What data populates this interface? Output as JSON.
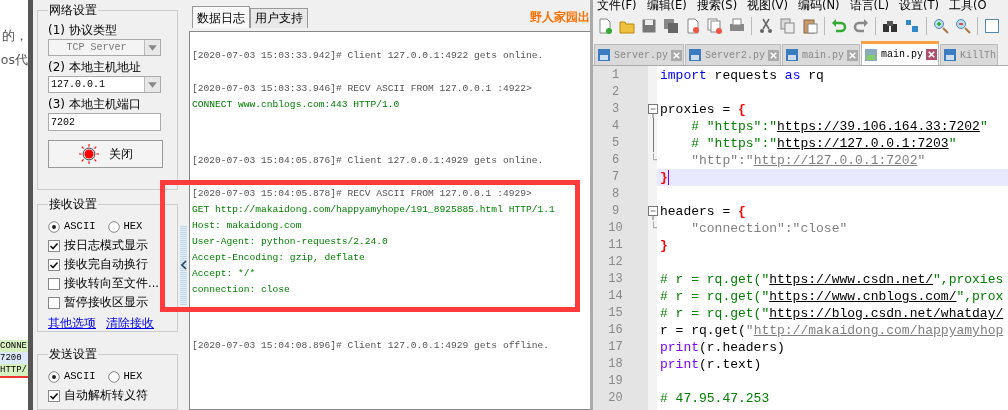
{
  "browser_fragment": {
    "texts": [
      "的，",
      "os代"
    ],
    "log_snippets": [
      "CONNE",
      "7200",
      "HTTP/"
    ]
  },
  "net_settings": {
    "title": "网络设置",
    "protocol_label": "(1) 协议类型",
    "protocol": "TCP Server",
    "protocol_disabled": true,
    "host_label": "(2) 本地主机地址",
    "host": "127.0.0.1",
    "port_label": "(3) 本地主机端口",
    "port": "7202",
    "connect_button": "关闭",
    "connected": true
  },
  "recv_settings": {
    "title": "接收设置",
    "modes": [
      {
        "label": "ASCII",
        "selected": true
      },
      {
        "label": "HEX",
        "selected": false
      }
    ],
    "options": [
      {
        "label": "按日志模式显示",
        "checked": true
      },
      {
        "label": "接收完自动换行",
        "checked": true
      },
      {
        "label": "接收转向至文件...",
        "checked": false
      },
      {
        "label": "暂停接收区显示",
        "checked": false
      }
    ],
    "links": [
      "其他选项",
      "清除接收"
    ]
  },
  "send_settings": {
    "title": "发送设置",
    "modes": [
      {
        "label": "ASCII",
        "selected": true
      },
      {
        "label": "HEX",
        "selected": false
      }
    ],
    "options": [
      {
        "label": "自动解析转义符",
        "checked": true
      }
    ]
  },
  "log_tabs": [
    {
      "label": "数据日志",
      "selected": true
    },
    {
      "label": "用户支持",
      "selected": false
    }
  ],
  "brand": "野人家园出",
  "log": [
    {
      "kind": "status",
      "text": "[2020-07-03 15:03:33.942]# Client 127.0.0.1:4922 gets online."
    },
    {
      "kind": "recv",
      "text": "[2020-07-03 15:03:33.946]# RECV ASCII FROM 127.0.0.1 :4922>",
      "data": [
        "CONNECT www.cnblogs.com:443 HTTP/1.0"
      ]
    },
    {
      "kind": "status",
      "text": "[2020-07-03 15:04:05.876]# Client 127.0.0.1:4929 gets online."
    },
    {
      "kind": "recv",
      "text": "[2020-07-03 15:04:05.878]# RECV ASCII FROM 127.0.0.1 :4929>",
      "data": [
        "GET http://makaidong.com/happyamyhope/191_8925885.html HTTP/1.1",
        "Host: makaidong.com",
        "User-Agent: python-requests/2.24.0",
        "Accept-Encoding: gzip, deflate",
        "Accept: */*",
        "connection: close"
      ],
      "highlighted": true
    },
    {
      "kind": "status",
      "text": "[2020-07-03 15:04:08.896]# Client 127.0.0.1:4929 gets offline."
    }
  ],
  "editor": {
    "menu": [
      "文件(F)",
      "编辑(E)",
      "搜索(S)",
      "视图(V)",
      "编码(N)",
      "语言(L)",
      "设置(T)",
      "工具(O"
    ],
    "tabs": [
      {
        "label": "Server.py",
        "selected": false
      },
      {
        "label": "Server2.py",
        "selected": false
      },
      {
        "label": "main.py",
        "selected": false
      },
      {
        "label": "main.py",
        "selected": true
      },
      {
        "label": "KillTh",
        "selected": false
      }
    ],
    "lines": [
      {
        "number": "1",
        "current": false,
        "tokens": [
          {
            "kind": "kw",
            "text": "import"
          },
          {
            "kind": "id",
            "text": " requests "
          },
          {
            "kind": "kw",
            "text": "as"
          },
          {
            "kind": "id",
            "text": " rq"
          }
        ]
      },
      {
        "number": "2",
        "current": false
      },
      {
        "number": "3",
        "current": false,
        "kind": "fold_start",
        "tokens": [
          {
            "kind": "id",
            "text": "proxies = "
          },
          {
            "kind": "op",
            "text": "{"
          }
        ]
      },
      {
        "number": "4",
        "current": false,
        "kind": "fold_mid",
        "tokens": [
          {
            "kind": "cm",
            "text": "    # \"https\":\""
          },
          {
            "kind": "curl",
            "text": "https://39.106.164.33:7202"
          },
          {
            "kind": "cm",
            "text": "\""
          }
        ]
      },
      {
        "number": "5",
        "current": false,
        "kind": "fold_mid",
        "tokens": [
          {
            "kind": "cm",
            "text": "    # \"https\":\""
          },
          {
            "kind": "curl",
            "text": "https://127.0.0.1:7203"
          },
          {
            "kind": "cm",
            "text": "\""
          }
        ]
      },
      {
        "number": "6",
        "current": false,
        "kind": "fold_end",
        "tokens": [
          {
            "kind": "str",
            "text": "    \"http\":\""
          },
          {
            "kind": "url",
            "text": "http://127.0.0.1:7202"
          },
          {
            "kind": "str",
            "text": "\""
          }
        ]
      },
      {
        "number": "7",
        "current": true,
        "tokens": [
          {
            "kind": "op",
            "text": "}"
          }
        ]
      },
      {
        "number": "8",
        "current": false
      },
      {
        "number": "9",
        "current": false,
        "kind": "fold_start",
        "tokens": [
          {
            "kind": "id",
            "text": "headers = "
          },
          {
            "kind": "op",
            "text": "{"
          }
        ]
      },
      {
        "number": "10",
        "current": false,
        "kind": "fold_end",
        "tokens": [
          {
            "kind": "str",
            "text": "    \"connection\":\"close\""
          }
        ]
      },
      {
        "number": "11",
        "current": false,
        "tokens": [
          {
            "kind": "op",
            "text": "}"
          }
        ]
      },
      {
        "number": "12",
        "current": false
      },
      {
        "number": "13",
        "current": false,
        "tokens": [
          {
            "kind": "cm",
            "text": "# r = rq.get(\""
          },
          {
            "kind": "curl",
            "text": "https://www.csdn.net/"
          },
          {
            "kind": "cm",
            "text": "\",proxies"
          }
        ]
      },
      {
        "number": "14",
        "current": false,
        "tokens": [
          {
            "kind": "cm",
            "text": "# r = rq.get(\""
          },
          {
            "kind": "curl",
            "text": "https://www.cnblogs.com/"
          },
          {
            "kind": "cm",
            "text": "\",prox"
          }
        ]
      },
      {
        "number": "15",
        "current": false,
        "tokens": [
          {
            "kind": "cm",
            "text": "# r = rq.get(\""
          },
          {
            "kind": "curl",
            "text": "https://blog.csdn.net/whatday/"
          }
        ]
      },
      {
        "number": "16",
        "current": false,
        "tokens": [
          {
            "kind": "id",
            "text": "r = rq.get("
          },
          {
            "kind": "str",
            "text": "\""
          },
          {
            "kind": "url",
            "text": "http://makaidong.com/happyamyhop"
          }
        ]
      },
      {
        "number": "17",
        "current": false,
        "tokens": [
          {
            "kind": "fn",
            "text": "print"
          },
          {
            "kind": "id",
            "text": "(r.headers)"
          }
        ]
      },
      {
        "number": "18",
        "current": false,
        "tokens": [
          {
            "kind": "fn",
            "text": "print"
          },
          {
            "kind": "id",
            "text": "(r.text)"
          }
        ]
      },
      {
        "number": "19",
        "current": false
      },
      {
        "number": "20",
        "current": false,
        "tokens": [
          {
            "kind": "cm",
            "text": "# 47.95.47.253"
          }
        ]
      }
    ]
  }
}
